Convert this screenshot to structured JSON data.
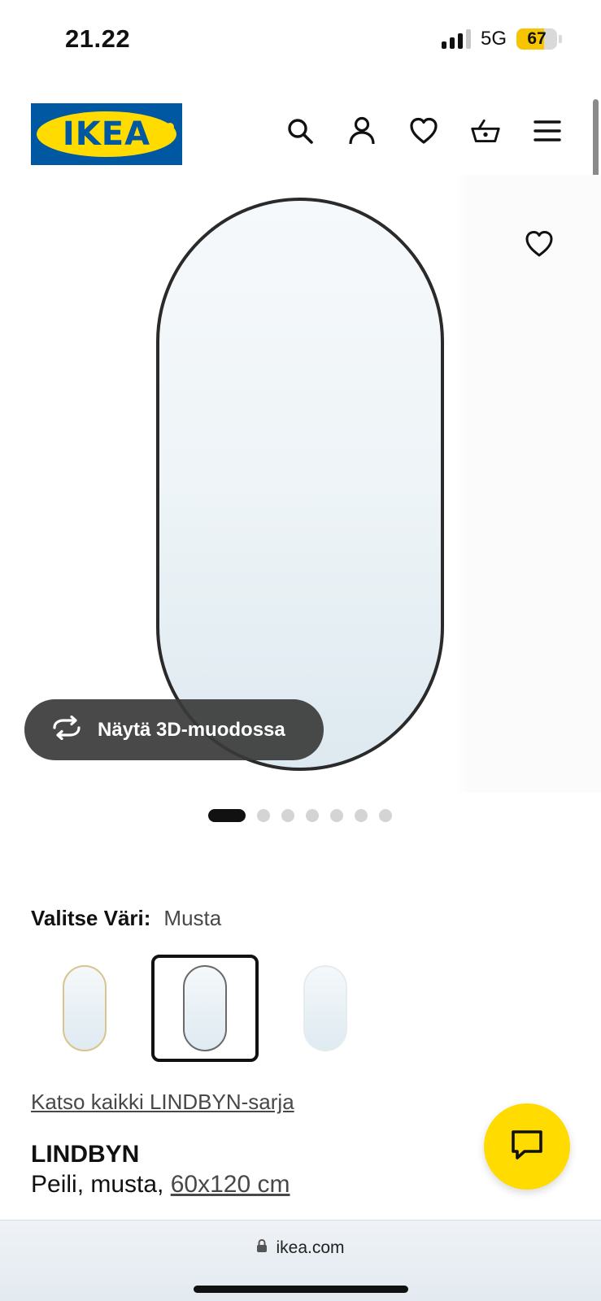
{
  "status_bar": {
    "time": "21.22",
    "network": "5G",
    "battery": "67",
    "battery_level": 0.67
  },
  "header": {
    "logo_text": "IKEA",
    "icons": [
      "search-icon",
      "user-icon",
      "heart-icon",
      "basket-icon",
      "menu-icon"
    ]
  },
  "gallery": {
    "view_3d_label": "Näytä 3D-muodossa",
    "image_count": 7,
    "active_index": 0
  },
  "color_select": {
    "label": "Valitse Väri:",
    "value": "Musta",
    "swatches": [
      {
        "name": "gold",
        "selected": false
      },
      {
        "name": "black",
        "selected": true
      },
      {
        "name": "white",
        "selected": false
      }
    ]
  },
  "product": {
    "series_link": "Katso kaikki LINDBYN-sarja",
    "name": "LINDBYN",
    "description_prefix": "Peili, musta, ",
    "size": "60x120 cm"
  },
  "browser": {
    "url": "ikea.com"
  },
  "colors": {
    "ikea_blue": "#0058a3",
    "ikea_yellow": "#ffdb00",
    "battery_yellow": "#f6c500"
  }
}
